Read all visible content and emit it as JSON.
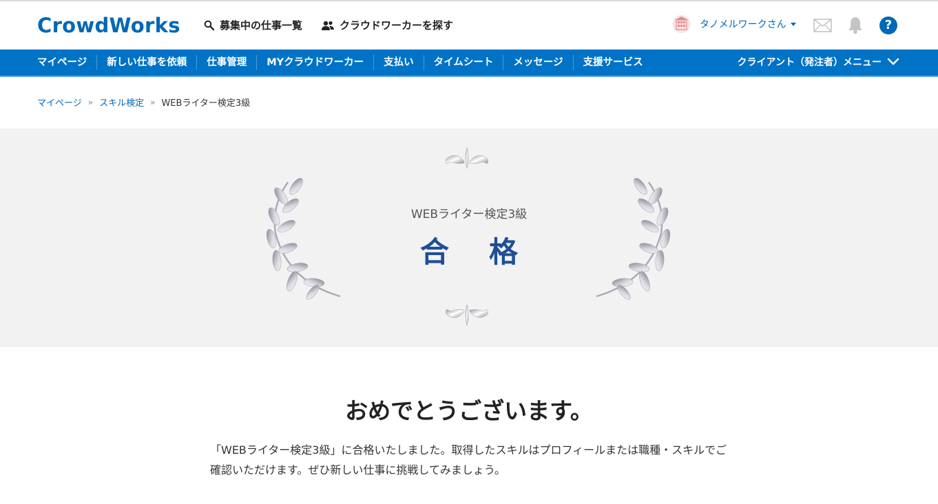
{
  "header": {
    "logo": "CrowdWorks",
    "links": [
      {
        "label": "募集中の仕事一覧",
        "icon": "search-icon"
      },
      {
        "label": "クラウドワーカーを探す",
        "icon": "users-icon"
      }
    ],
    "user_name": "タノメルワークさん",
    "icons": [
      "mail-icon",
      "bell-icon",
      "help-icon"
    ],
    "help_glyph": "?"
  },
  "nav": {
    "items": [
      "マイページ",
      "新しい仕事を依頼",
      "仕事管理",
      "MYクラウドワーカー",
      "支払い",
      "タイムシート",
      "メッセージ",
      "支援サービス"
    ],
    "menu_label": "クライアント（発注者）メニュー"
  },
  "breadcrumb": {
    "items": [
      "マイページ",
      "スキル検定"
    ],
    "separator": "»",
    "current": "WEBライター検定3級"
  },
  "hero": {
    "subtitle": "WEBライター検定3級",
    "title": "合格"
  },
  "main": {
    "heading": "おめでとうございます。",
    "message": "「WEBライター検定3級」に合格いたしました。取得したスキルはプロフィールまたは職種・スキルでご確認いただけます。ぜひ新しい仕事に挑戦してみましょう。"
  },
  "colors": {
    "brand": "#0068b7",
    "nav_bg": "#0073c6",
    "hero_bg": "#f2f2f2",
    "title": "#1e4f96"
  }
}
